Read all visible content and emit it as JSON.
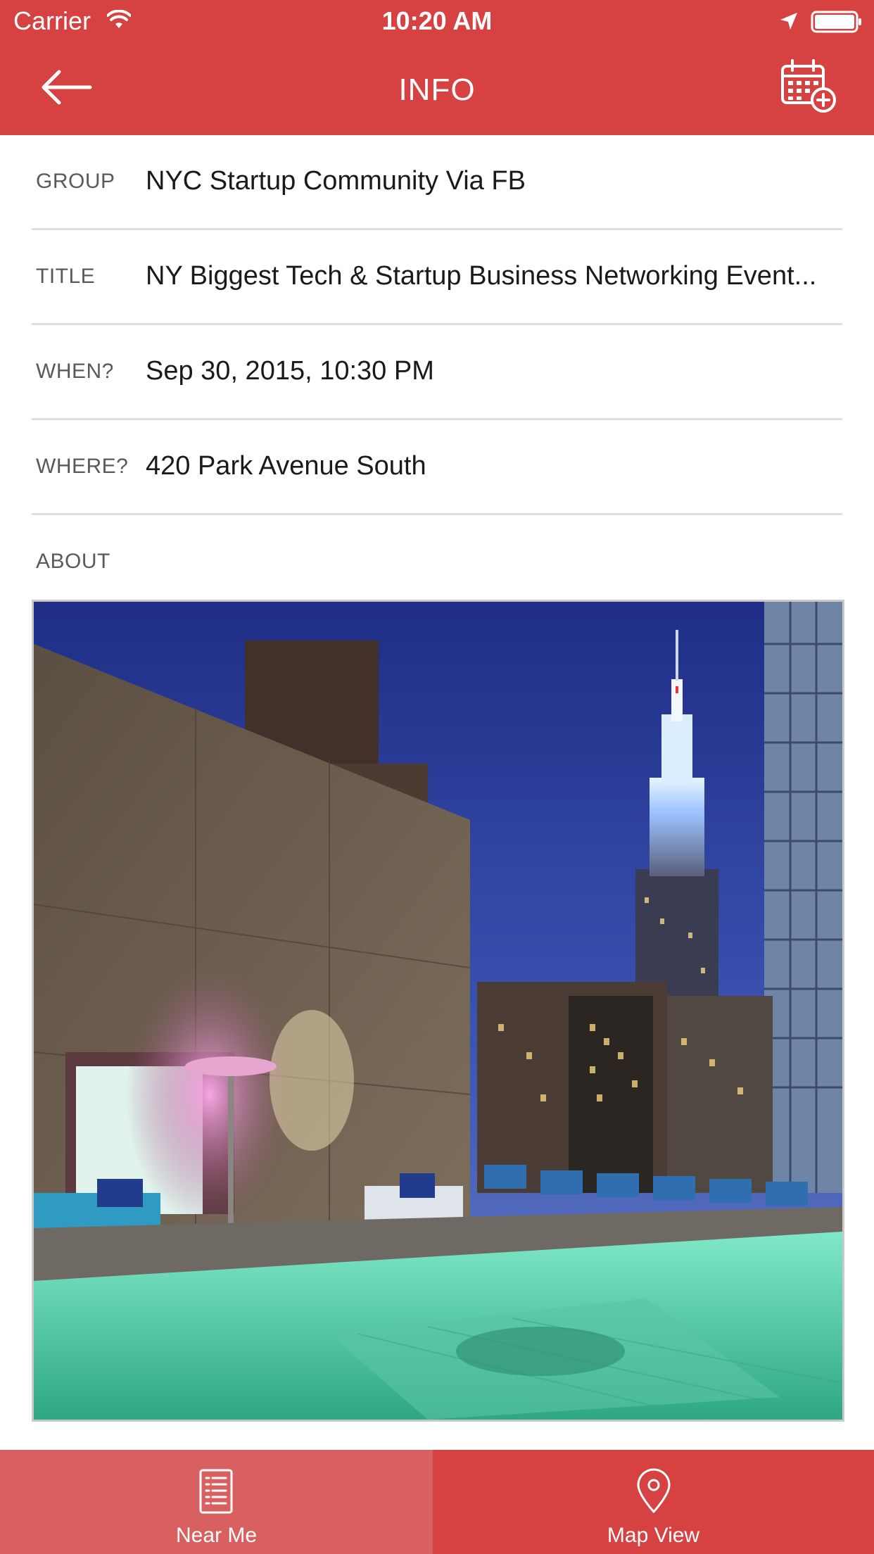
{
  "status_bar": {
    "carrier": "Carrier",
    "time": "10:20 AM",
    "icons": [
      "wifi-icon",
      "location-arrow-icon",
      "battery-icon"
    ]
  },
  "nav": {
    "title": "INFO",
    "back_icon": "arrow-left-icon",
    "action_icon": "calendar-add-icon"
  },
  "details": [
    {
      "label": "GROUP",
      "value": "NYC Startup Community Via FB"
    },
    {
      "label": "TITLE",
      "value": "NY Biggest Tech & Startup Business Networking Event..."
    },
    {
      "label": "WHEN?",
      "value": "Sep 30, 2015, 10:30 PM"
    },
    {
      "label": "WHERE?",
      "value": "420 Park Avenue South"
    }
  ],
  "about": {
    "label": "ABOUT"
  },
  "tabs": [
    {
      "label": "Near Me",
      "icon": "list-document-icon",
      "selected": true
    },
    {
      "label": "Map View",
      "icon": "map-pin-icon",
      "selected": false
    }
  ],
  "colors": {
    "brand_red": "#d64141",
    "tab_selected": "#d86060",
    "divider": "#dedede",
    "label_gray": "#5a5a5a"
  }
}
